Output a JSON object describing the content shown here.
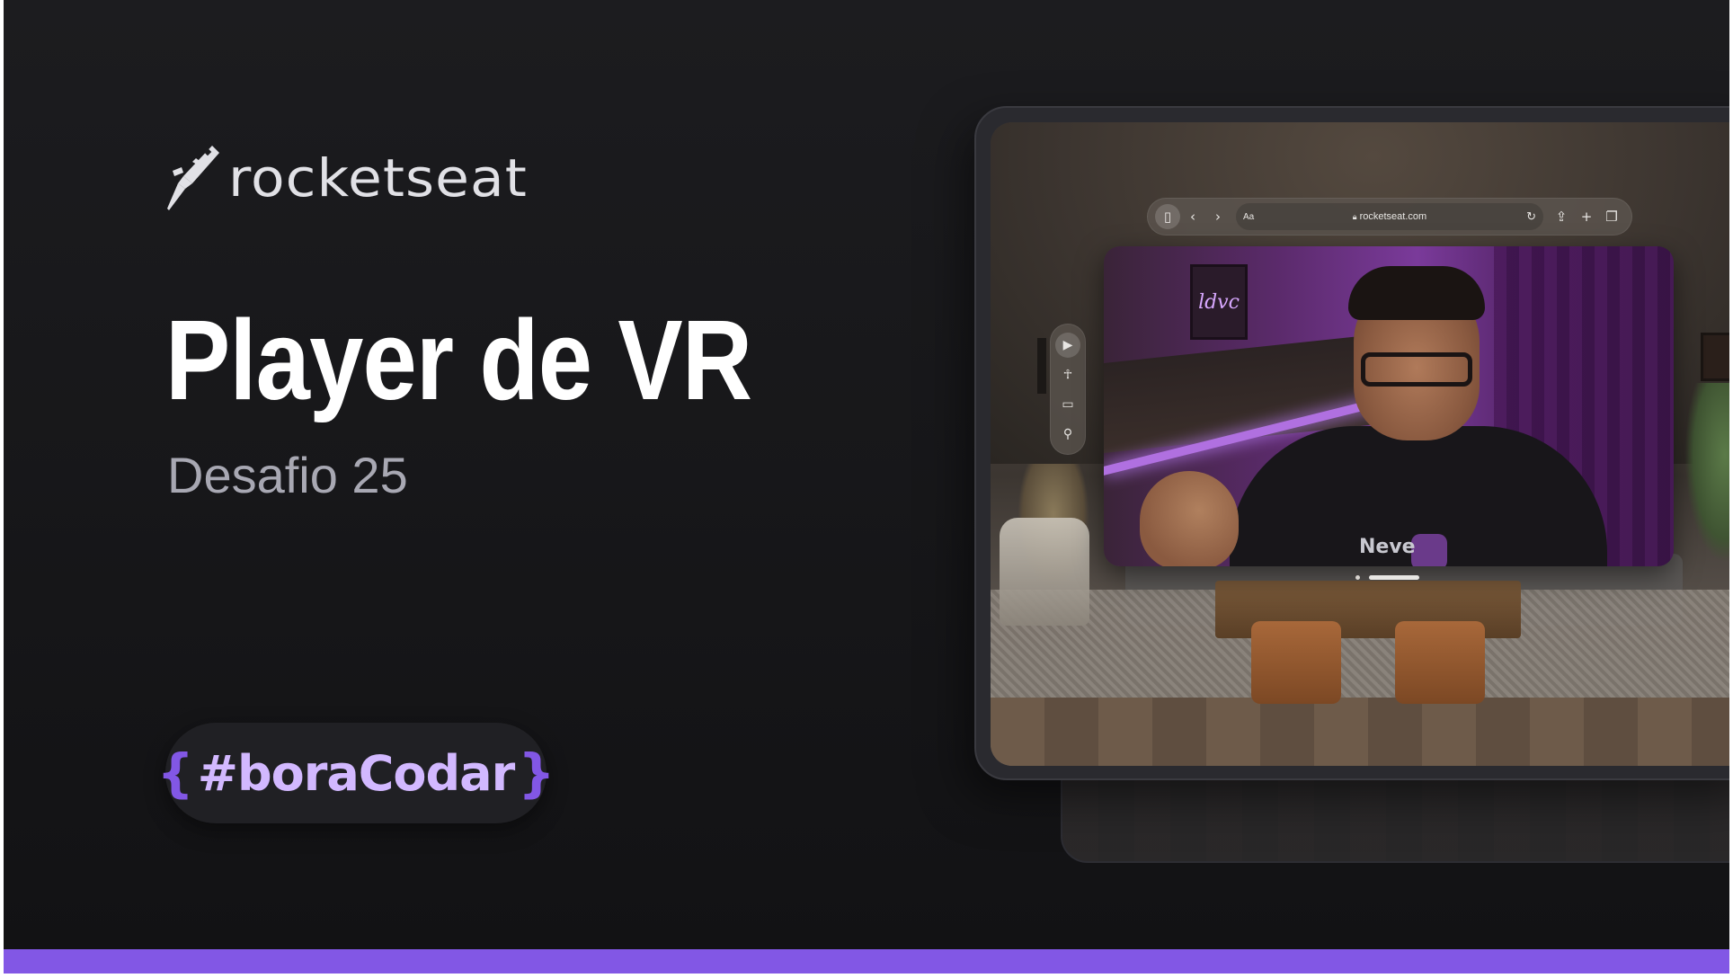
{
  "brand": {
    "name": "rocketseat",
    "accent": "#8257e5",
    "tag_text_color": "#d2b8ff"
  },
  "hero": {
    "title": "Player de VR",
    "subtitle": "Desafio 25"
  },
  "tag": {
    "open_brace": "{",
    "text": "#boraCodar",
    "close_brace": "}"
  },
  "browser": {
    "sidebar_icon": "sidebar-icon",
    "back_icon": "chevron-left-icon",
    "forward_icon": "chevron-right-icon",
    "reader_label": "Aa",
    "url": "rocketseat.com",
    "reload_icon": "reload-icon",
    "share_icon": "share-icon",
    "new_tab_icon": "plus-icon",
    "tabs_icon": "tabs-icon"
  },
  "video": {
    "sign_text": "ldvc",
    "shirt_text": "Neve"
  },
  "side_tools": [
    "play-icon",
    "accessibility-icon",
    "window-icon",
    "search-icon"
  ]
}
